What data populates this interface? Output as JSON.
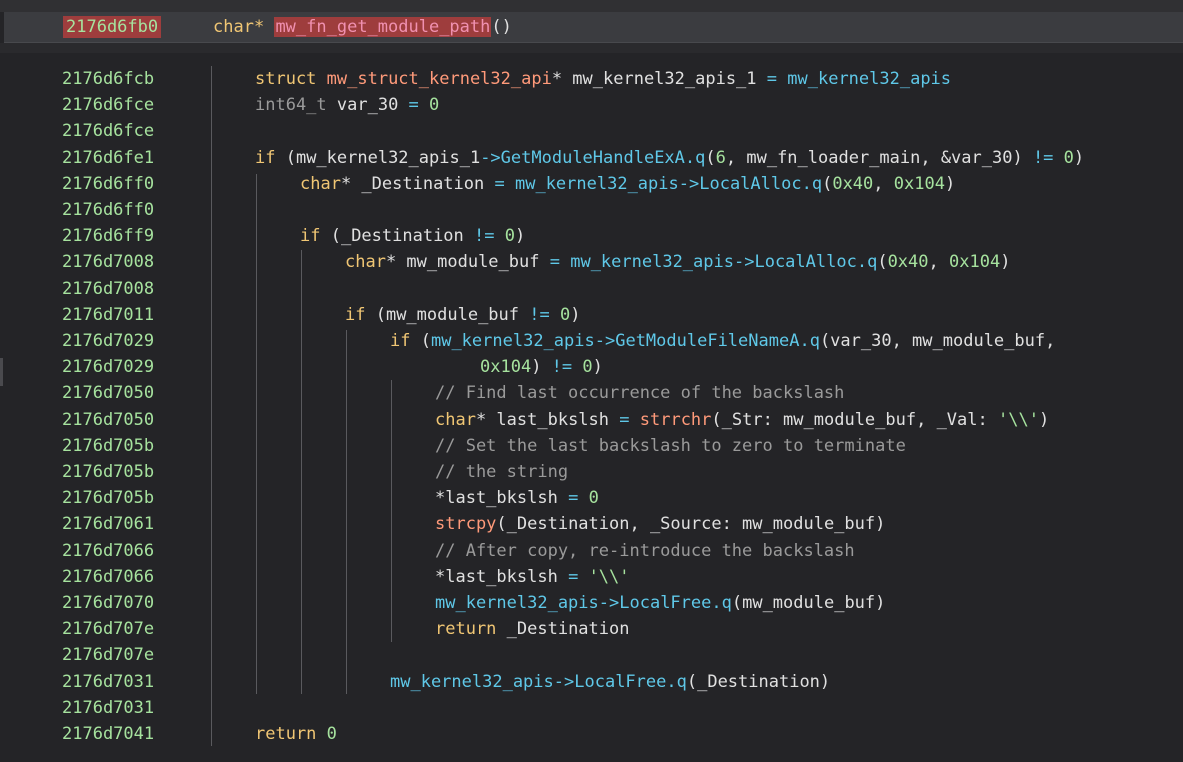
{
  "header": {
    "address": "2176d6fb0",
    "return_type": "char*",
    "function_name": "mw_fn_get_module_path",
    "parens": "()"
  },
  "lines": [
    {
      "addr": "2176d6fcb",
      "tokens": [
        [
          "struct ",
          "kw"
        ],
        [
          "mw_struct_kernel32_api",
          "fn"
        ],
        [
          "* mw_kernel32_apis_1 ",
          "pl"
        ],
        [
          "=",
          "op"
        ],
        [
          " ",
          "pl"
        ],
        [
          "mw_kernel32_apis",
          "gl"
        ]
      ]
    },
    {
      "addr": "2176d6fce",
      "tokens": [
        [
          "int64_t",
          "ty2"
        ],
        [
          " var_30 ",
          "pl"
        ],
        [
          "=",
          "op"
        ],
        [
          " ",
          "pl"
        ],
        [
          "0",
          "num"
        ]
      ]
    },
    {
      "addr": "2176d6fce",
      "tokens": []
    },
    {
      "addr": "2176d6fe1",
      "tokens": [
        [
          "if",
          "kw"
        ],
        [
          " (mw_kernel32_apis_1",
          "pl"
        ],
        [
          "->",
          "op"
        ],
        [
          "GetModuleHandleExA",
          "im"
        ],
        [
          ".q",
          "gl"
        ],
        [
          "(",
          "pl"
        ],
        [
          "6",
          "num"
        ],
        [
          ", mw_fn_loader_main, &var_30) ",
          "pl"
        ],
        [
          "!=",
          "op"
        ],
        [
          " ",
          "pl"
        ],
        [
          "0",
          "num"
        ],
        [
          ")",
          "pl"
        ]
      ]
    },
    {
      "addr": "2176d6ff0",
      "tokens": [
        [
          "char",
          "ty"
        ],
        [
          "* _Destination ",
          "pl"
        ],
        [
          "=",
          "op"
        ],
        [
          " ",
          "pl"
        ],
        [
          "mw_kernel32_apis",
          "gl"
        ],
        [
          "->",
          "op"
        ],
        [
          "LocalAlloc",
          "im"
        ],
        [
          ".q",
          "gl"
        ],
        [
          "(",
          "pl"
        ],
        [
          "0x40",
          "num"
        ],
        [
          ", ",
          "pl"
        ],
        [
          "0x104",
          "num"
        ],
        [
          ")",
          "pl"
        ]
      ]
    },
    {
      "addr": "2176d6ff0",
      "tokens": []
    },
    {
      "addr": "2176d6ff9",
      "tokens": [
        [
          "if",
          "kw"
        ],
        [
          " (_Destination ",
          "pl"
        ],
        [
          "!=",
          "op"
        ],
        [
          " ",
          "pl"
        ],
        [
          "0",
          "num"
        ],
        [
          ")",
          "pl"
        ]
      ]
    },
    {
      "addr": "2176d7008",
      "tokens": [
        [
          "char",
          "ty"
        ],
        [
          "* mw_module_buf ",
          "pl"
        ],
        [
          "=",
          "op"
        ],
        [
          " ",
          "pl"
        ],
        [
          "mw_kernel32_apis",
          "gl"
        ],
        [
          "->",
          "op"
        ],
        [
          "LocalAlloc",
          "im"
        ],
        [
          ".q",
          "gl"
        ],
        [
          "(",
          "pl"
        ],
        [
          "0x40",
          "num"
        ],
        [
          ", ",
          "pl"
        ],
        [
          "0x104",
          "num"
        ],
        [
          ")",
          "pl"
        ]
      ]
    },
    {
      "addr": "2176d7008",
      "tokens": []
    },
    {
      "addr": "2176d7011",
      "tokens": [
        [
          "if",
          "kw"
        ],
        [
          " (mw_module_buf ",
          "pl"
        ],
        [
          "!=",
          "op"
        ],
        [
          " ",
          "pl"
        ],
        [
          "0",
          "num"
        ],
        [
          ")",
          "pl"
        ]
      ]
    },
    {
      "addr": "2176d7029",
      "tokens": [
        [
          "if",
          "kw"
        ],
        [
          " (",
          "pl"
        ],
        [
          "mw_kernel32_apis",
          "gl"
        ],
        [
          "->",
          "op"
        ],
        [
          "GetModuleFileNameA",
          "im"
        ],
        [
          ".q",
          "gl"
        ],
        [
          "(var_30, mw_module_buf,",
          "pl"
        ]
      ]
    },
    {
      "addr": "2176d7029",
      "tokens": [
        [
          "0x104",
          "num"
        ],
        [
          ") ",
          "pl"
        ],
        [
          "!=",
          "op"
        ],
        [
          " ",
          "pl"
        ],
        [
          "0",
          "num"
        ],
        [
          ")",
          "pl"
        ]
      ]
    },
    {
      "addr": "2176d7050",
      "tokens": [
        [
          "// Find last occurrence of the backslash",
          "cm"
        ]
      ]
    },
    {
      "addr": "2176d7050",
      "tokens": [
        [
          "char",
          "ty"
        ],
        [
          "* last_bkslsh ",
          "pl"
        ],
        [
          "=",
          "op"
        ],
        [
          " ",
          "pl"
        ],
        [
          "strrchr",
          "fn"
        ],
        [
          "(_Str: mw_module_buf, _Val: ",
          "pl"
        ],
        [
          "'\\\\'",
          "str"
        ],
        [
          ")",
          "pl"
        ]
      ]
    },
    {
      "addr": "2176d705b",
      "tokens": [
        [
          "// Set the last backslash to zero to terminate",
          "cm"
        ]
      ]
    },
    {
      "addr": "2176d705b",
      "tokens": [
        [
          "// the string",
          "cm"
        ]
      ]
    },
    {
      "addr": "2176d705b",
      "tokens": [
        [
          "*last_bkslsh ",
          "pl"
        ],
        [
          "=",
          "op"
        ],
        [
          " ",
          "pl"
        ],
        [
          "0",
          "num"
        ]
      ]
    },
    {
      "addr": "2176d7061",
      "tokens": [
        [
          "strcpy",
          "fn"
        ],
        [
          "(_Destination, _Source: mw_module_buf)",
          "pl"
        ]
      ]
    },
    {
      "addr": "2176d7066",
      "tokens": [
        [
          "// After copy, re-introduce the backslash",
          "cm"
        ]
      ]
    },
    {
      "addr": "2176d7066",
      "tokens": [
        [
          "*last_bkslsh ",
          "pl"
        ],
        [
          "=",
          "op"
        ],
        [
          " ",
          "pl"
        ],
        [
          "'\\\\'",
          "str"
        ]
      ]
    },
    {
      "addr": "2176d7070",
      "tokens": [
        [
          "mw_kernel32_apis",
          "gl"
        ],
        [
          "->",
          "op"
        ],
        [
          "LocalFree",
          "im"
        ],
        [
          ".q",
          "gl"
        ],
        [
          "(mw_module_buf)",
          "pl"
        ]
      ]
    },
    {
      "addr": "2176d707e",
      "tokens": [
        [
          "return",
          "kw"
        ],
        [
          " _Destination",
          "pl"
        ]
      ]
    },
    {
      "addr": "2176d707e",
      "tokens": []
    },
    {
      "addr": "2176d7031",
      "tokens": [
        [
          "mw_kernel32_apis",
          "gl"
        ],
        [
          "->",
          "op"
        ],
        [
          "LocalFree",
          "im"
        ],
        [
          ".q",
          "gl"
        ],
        [
          "(_Destination)",
          "pl"
        ]
      ]
    },
    {
      "addr": "2176d7031",
      "tokens": []
    },
    {
      "addr": "2176d7041",
      "tokens": [
        [
          "return",
          "kw"
        ],
        [
          " ",
          "pl"
        ],
        [
          "0",
          "num"
        ]
      ]
    }
  ]
}
